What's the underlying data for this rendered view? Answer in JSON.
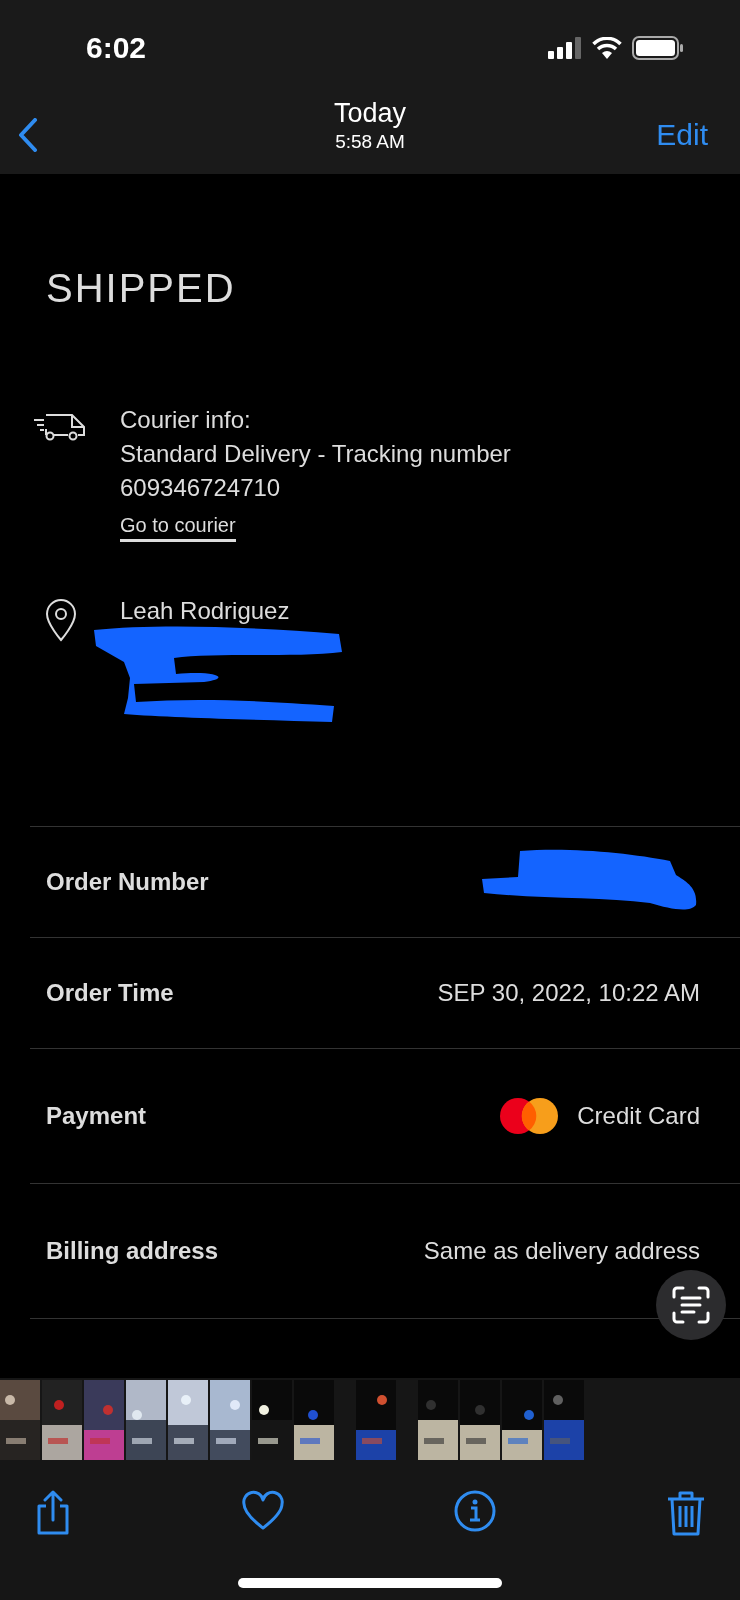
{
  "status_bar": {
    "time": "6:02"
  },
  "nav": {
    "title": "Today",
    "subtitle": "5:58 AM",
    "action": "Edit"
  },
  "order": {
    "status": "SHIPPED",
    "courier": {
      "heading": "Courier info:",
      "method": "Standard Delivery - Tracking number",
      "tracking": "609346724710",
      "link": "Go to courier"
    },
    "address": {
      "name": "Leah Rodriguez",
      "redacted": true
    },
    "rows": [
      {
        "kind": "redacted",
        "label": "Order Number"
      },
      {
        "kind": "text",
        "label": "Order Time",
        "value": "SEP 30, 2022, 10:22 AM"
      },
      {
        "kind": "payment",
        "label": "Payment",
        "value": "Credit Card"
      },
      {
        "kind": "text",
        "label": "Billing address",
        "value": "Same as delivery address"
      }
    ]
  }
}
